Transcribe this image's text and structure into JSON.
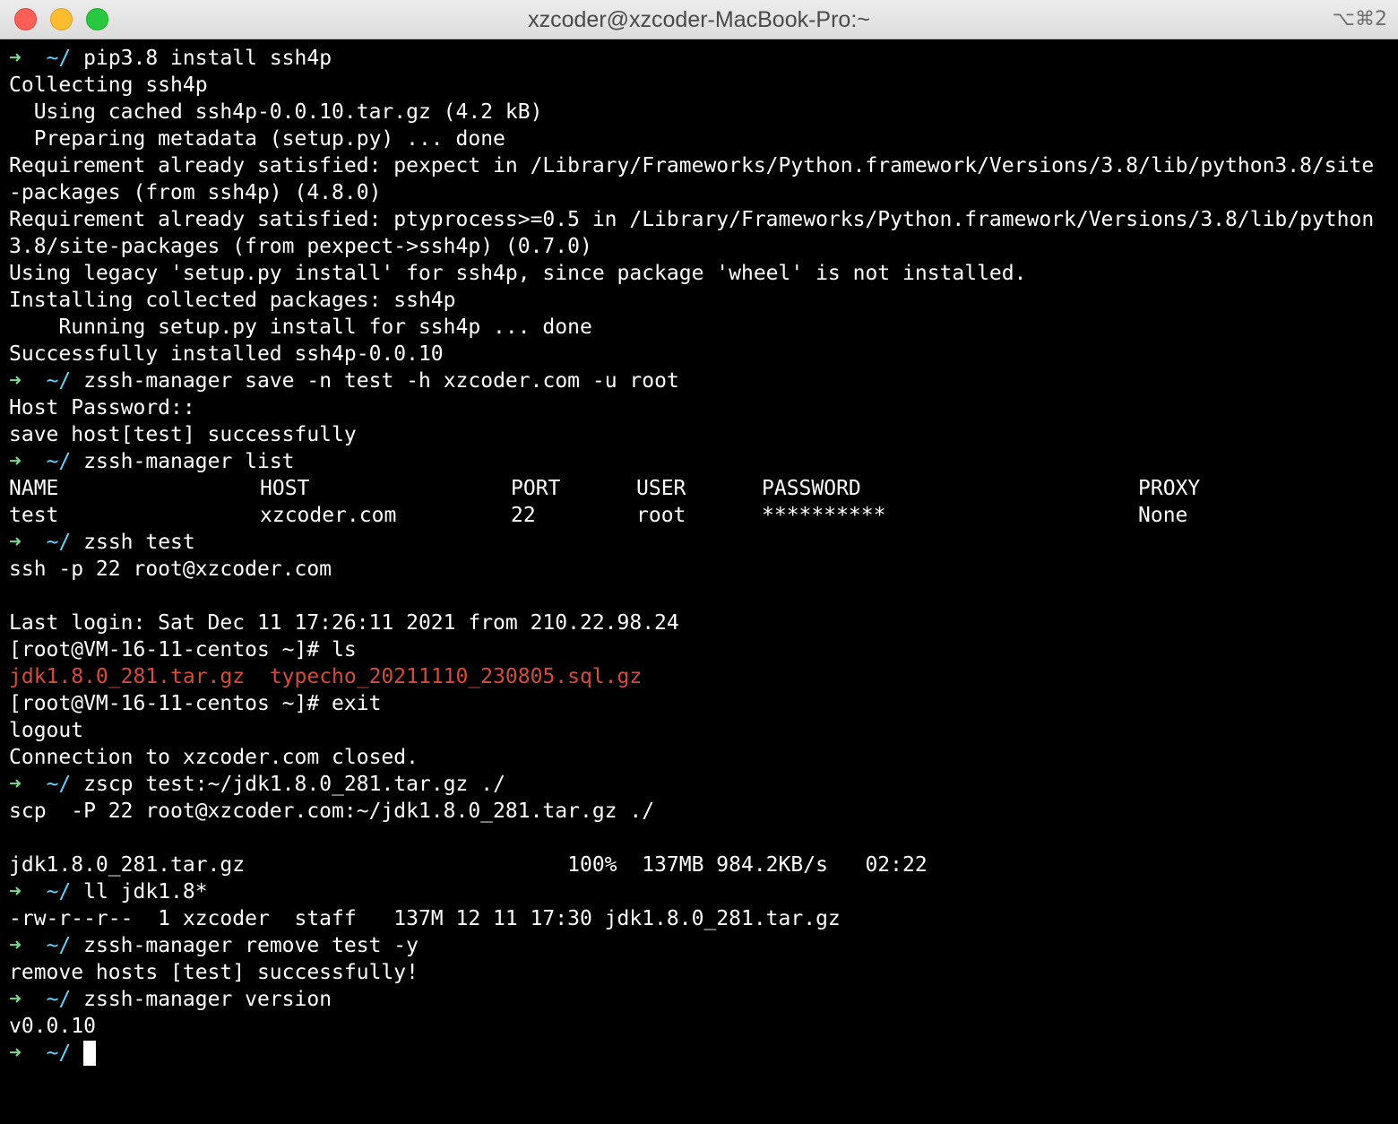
{
  "window": {
    "title": "xzcoder@xzcoder-MacBook-Pro:~",
    "shortcut": "⌥⌘2"
  },
  "prompt": {
    "arrow": "➜",
    "dir": "~/"
  },
  "lines": {
    "l01": "pip3.8 install ssh4p",
    "l02": "Collecting ssh4p",
    "l03": "  Using cached ssh4p-0.0.10.tar.gz (4.2 kB)",
    "l04": "  Preparing metadata (setup.py) ... done",
    "l05": "Requirement already satisfied: pexpect in /Library/Frameworks/Python.framework/Versions/3.8/lib/python3.8/site",
    "l06": "-packages (from ssh4p) (4.8.0)",
    "l07": "Requirement already satisfied: ptyprocess>=0.5 in /Library/Frameworks/Python.framework/Versions/3.8/lib/python",
    "l08": "3.8/site-packages (from pexpect->ssh4p) (0.7.0)",
    "l09": "Using legacy 'setup.py install' for ssh4p, since package 'wheel' is not installed.",
    "l10": "Installing collected packages: ssh4p",
    "l11": "    Running setup.py install for ssh4p ... done",
    "l12": "Successfully installed ssh4p-0.0.10",
    "l13": "zssh-manager save -n test -h xzcoder.com -u root",
    "l14": "Host Password::",
    "l15": "save host[test] successfully",
    "l16": "zssh-manager list",
    "l19": "zssh test",
    "l20": "ssh -p 22 root@xzcoder.com",
    "l22": "Last login: Sat Dec 11 17:26:11 2021 from 210.22.98.24",
    "l23": "[root@VM-16-11-centos ~]# ls",
    "l24a": "jdk1.8.0_281.tar.gz",
    "l24b": "typecho_20211110_230805.sql.gz",
    "l25": "[root@VM-16-11-centos ~]# exit",
    "l26": "logout",
    "l27": "Connection to xzcoder.com closed.",
    "l28": "zscp test:~/jdk1.8.0_281.tar.gz ./",
    "l29": "scp  -P 22 root@xzcoder.com:~/jdk1.8.0_281.tar.gz ./",
    "l31": "jdk1.8.0_281.tar.gz                          100%  137MB 984.2KB/s   02:22",
    "l32": "ll jdk1.8*",
    "l33": "-rw-r--r--  1 xzcoder  staff   137M 12 11 17:30 jdk1.8.0_281.tar.gz",
    "l34": "zssh-manager remove test -y",
    "l35": "remove hosts [test] successfully!",
    "l36": "zssh-manager version",
    "l37": "v0.0.10"
  },
  "host_table": {
    "headers": [
      "NAME",
      "HOST",
      "PORT",
      "USER",
      "PASSWORD",
      "PROXY"
    ],
    "row": [
      "test",
      "xzcoder.com",
      "22",
      "root",
      "**********",
      "None"
    ]
  },
  "colors": {
    "background": "#000000",
    "text": "#ffffff",
    "prompt_arrow": "#7bd88f",
    "prompt_dir": "#5fd7ff",
    "archive_file": "#d94a3a"
  }
}
